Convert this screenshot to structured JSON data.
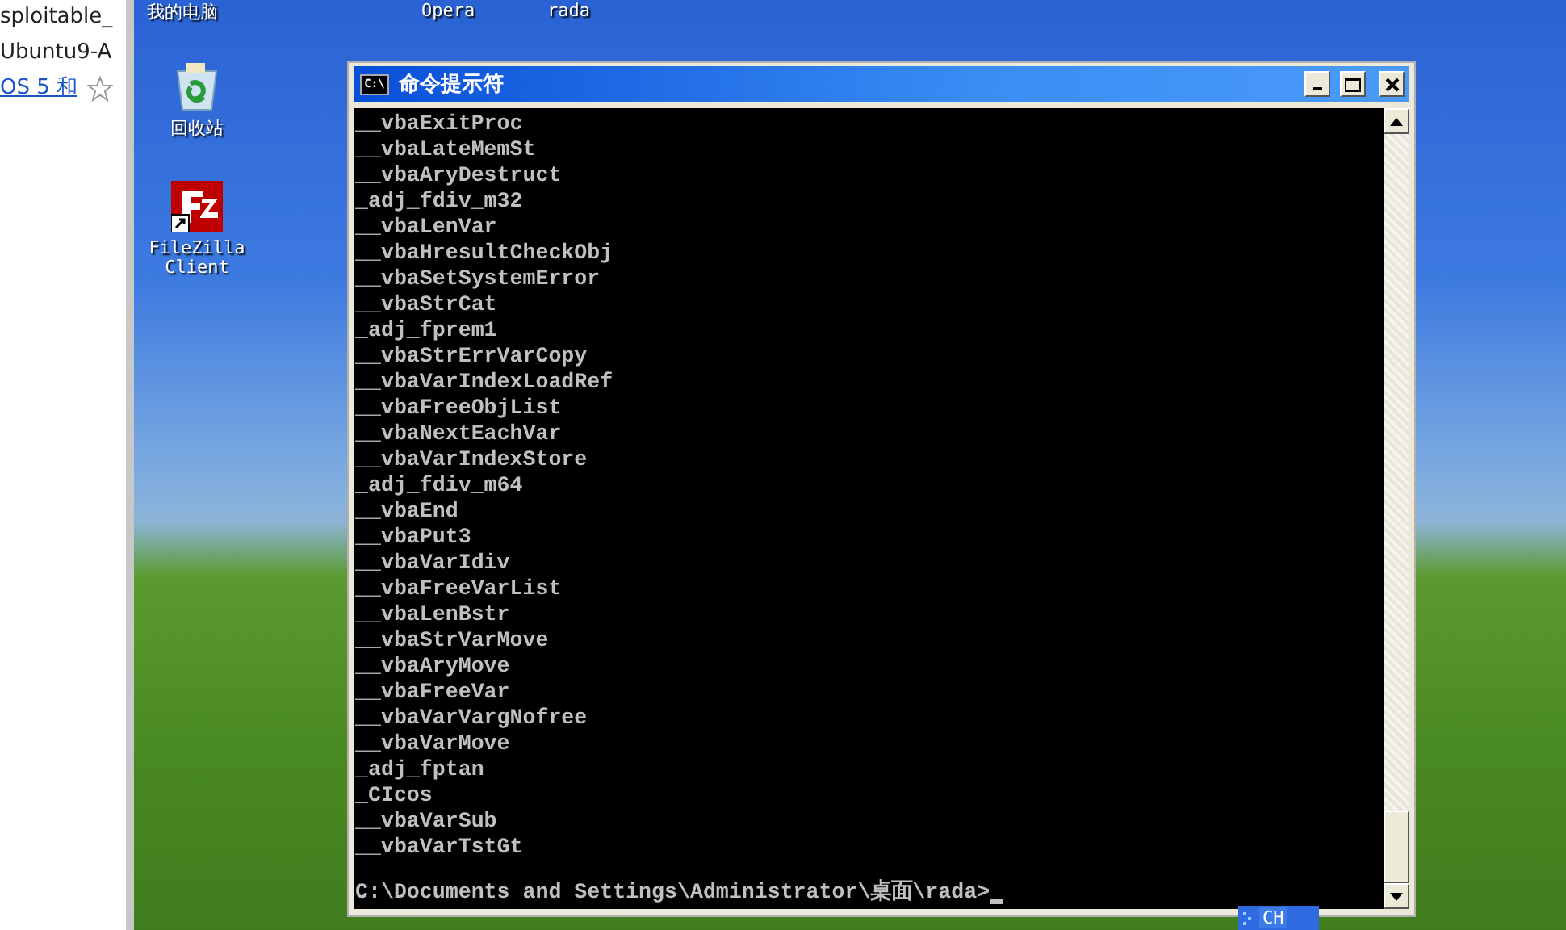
{
  "browser_panel": {
    "lines": [
      "sploitable_",
      "Ubuntu9-A"
    ],
    "link": "OS 5 和"
  },
  "top_labels": [
    "我的电脑",
    "Opera",
    "rada"
  ],
  "desktop_icons": [
    {
      "label": "回收站",
      "kind": "recycle-bin"
    },
    {
      "label": "FileZilla Client",
      "kind": "filezilla"
    }
  ],
  "window": {
    "title": "命令提示符",
    "icon": "C:\\"
  },
  "console": {
    "lines": [
      "__vbaExitProc",
      "__vbaLateMemSt",
      "__vbaAryDestruct",
      "_adj_fdiv_m32",
      "__vbaLenVar",
      "__vbaHresultCheckObj",
      "__vbaSetSystemError",
      "__vbaStrCat",
      "_adj_fprem1",
      "__vbaStrErrVarCopy",
      "__vbaVarIndexLoadRef",
      "__vbaFreeObjList",
      "__vbaNextEachVar",
      "__vbaVarIndexStore",
      "_adj_fdiv_m64",
      "__vbaEnd",
      "__vbaPut3",
      "__vbaVarIdiv",
      "__vbaFreeVarList",
      "__vbaLenBstr",
      "__vbaStrVarMove",
      "__vbaAryMove",
      "__vbaFreeVar",
      "__vbaVarVargNofree",
      "__vbaVarMove",
      "_adj_fptan",
      "_CIcos",
      "__vbaVarSub",
      "__vbaVarTstGt"
    ],
    "prompt": "C:\\Documents and Settings\\Administrator\\桌面\\rada>"
  },
  "language_bar": {
    "label": "CH"
  }
}
